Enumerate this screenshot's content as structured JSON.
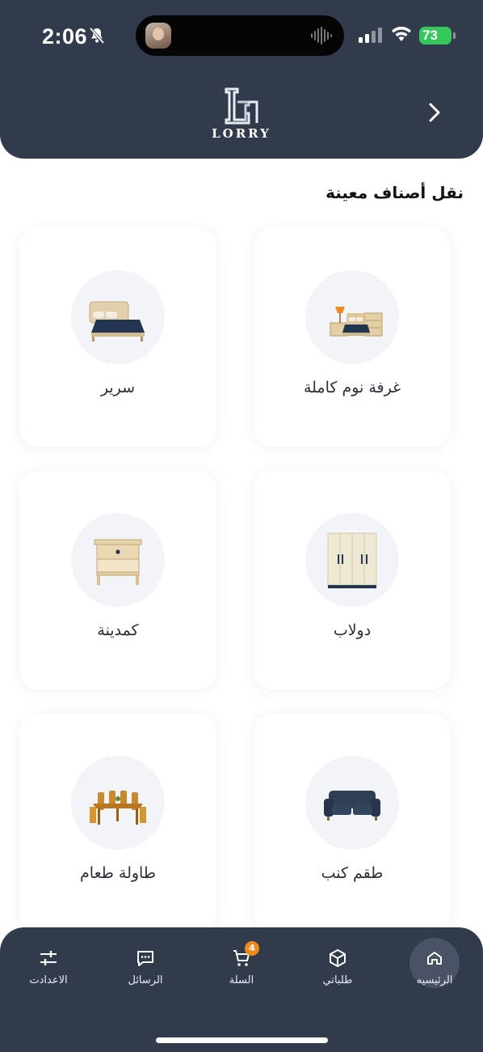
{
  "status_bar": {
    "time": "2:06",
    "battery": "73"
  },
  "header": {
    "brand": "LORRY",
    "back_icon": "chevron-right-icon"
  },
  "section": {
    "title": "نقل أصناف معينة"
  },
  "categories": [
    {
      "label": "غرفة نوم كاملة",
      "icon": "bedroom-set-image"
    },
    {
      "label": "سرير",
      "icon": "bed-image"
    },
    {
      "label": "دولاب",
      "icon": "wardrobe-image"
    },
    {
      "label": "كمدينة",
      "icon": "nightstand-image"
    },
    {
      "label": "طقم كنب",
      "icon": "sofa-image"
    },
    {
      "label": "طاولة طعام",
      "icon": "dining-table-image"
    }
  ],
  "bottom_nav": {
    "items": [
      {
        "label": "الرئيسيه",
        "icon": "home-icon",
        "active": true
      },
      {
        "label": "طلباتي",
        "icon": "box-icon"
      },
      {
        "label": "السلة",
        "icon": "cart-icon",
        "badge": "4"
      },
      {
        "label": "الرسائل",
        "icon": "chat-icon"
      },
      {
        "label": "الاعدادت",
        "icon": "sliders-icon"
      }
    ]
  },
  "colors": {
    "header_bg": "#323b4c",
    "badge": "#f28a1a",
    "battery": "#34c759"
  }
}
